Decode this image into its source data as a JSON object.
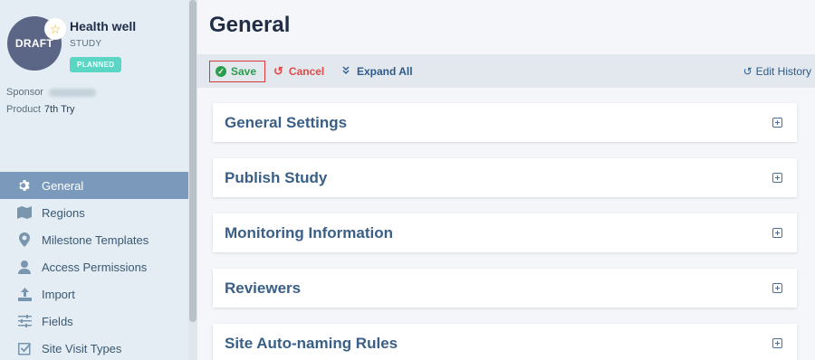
{
  "study": {
    "avatar_label": "DRAFT",
    "name": "Health well",
    "type": "STUDY",
    "status": "PLANNED",
    "sponsor_label": "Sponsor",
    "product_label": "Product",
    "product_value": "7th Try"
  },
  "sidebar": {
    "items": [
      {
        "label": "General",
        "icon": "gear-icon"
      },
      {
        "label": "Regions",
        "icon": "map-icon"
      },
      {
        "label": "Milestone Templates",
        "icon": "pin-icon"
      },
      {
        "label": "Access Permissions",
        "icon": "user-icon"
      },
      {
        "label": "Import",
        "icon": "upload-icon"
      },
      {
        "label": "Fields",
        "icon": "sliders-icon"
      },
      {
        "label": "Site Visit Types",
        "icon": "checkbox-icon"
      }
    ]
  },
  "main": {
    "title": "General",
    "toolbar": {
      "save": "Save",
      "cancel": "Cancel",
      "expand_all": "Expand All",
      "edit_history": "Edit History"
    },
    "panels": [
      "General Settings",
      "Publish Study",
      "Monitoring Information",
      "Reviewers",
      "Site Auto-naming Rules"
    ]
  },
  "colors": {
    "accent": "#7a99bb",
    "save_green": "#2b9d4e",
    "cancel_red": "#e04b4b",
    "badge": "#5bd6c4"
  }
}
